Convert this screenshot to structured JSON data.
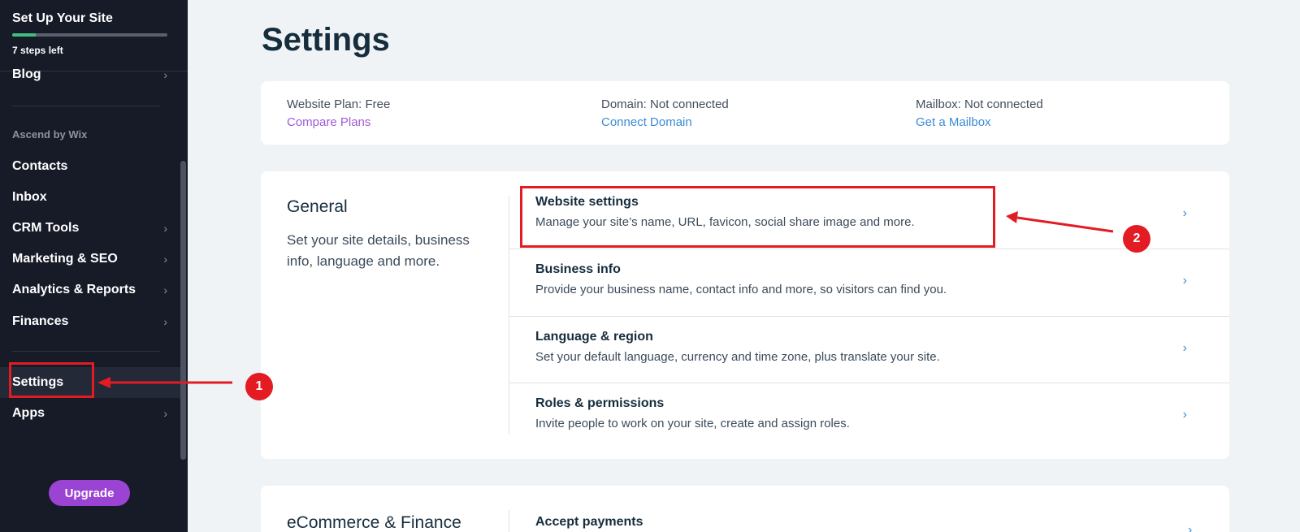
{
  "sidebar": {
    "setup": {
      "title": "Set Up Your Site",
      "steps_left": "7 steps left",
      "progress_fraction": 0.15
    },
    "blog": "Blog",
    "section_label": "Ascend by Wix",
    "items": {
      "contacts": "Contacts",
      "inbox": "Inbox",
      "crm": "CRM Tools",
      "marketing": "Marketing & SEO",
      "analytics": "Analytics & Reports",
      "finances": "Finances",
      "settings": "Settings",
      "apps": "Apps"
    },
    "upgrade": "Upgrade"
  },
  "main": {
    "title": "Settings",
    "plan": {
      "website_plan": "Website Plan: Free",
      "compare": "Compare Plans",
      "domain": "Domain: Not connected",
      "connect": "Connect Domain",
      "mailbox": "Mailbox: Not connected",
      "get_mailbox": "Get a Mailbox"
    },
    "general": {
      "title": "General",
      "description": "Set your site details, business info, language and more.",
      "rows": [
        {
          "title": "Website settings",
          "desc": "Manage your site’s name, URL, favicon, social share image and more."
        },
        {
          "title": "Business info",
          "desc": "Provide your business name, contact info and more, so visitors can find you."
        },
        {
          "title": "Language & region",
          "desc": "Set your default language, currency and time zone, plus translate your site."
        },
        {
          "title": "Roles & permissions",
          "desc": "Invite people to work on your site, create and assign roles."
        }
      ]
    },
    "ecommerce": {
      "title": "eCommerce & Finance",
      "first_row": "Accept payments"
    }
  },
  "annotations": {
    "badge1": "1",
    "badge2": "2",
    "color": "#e31b23"
  }
}
